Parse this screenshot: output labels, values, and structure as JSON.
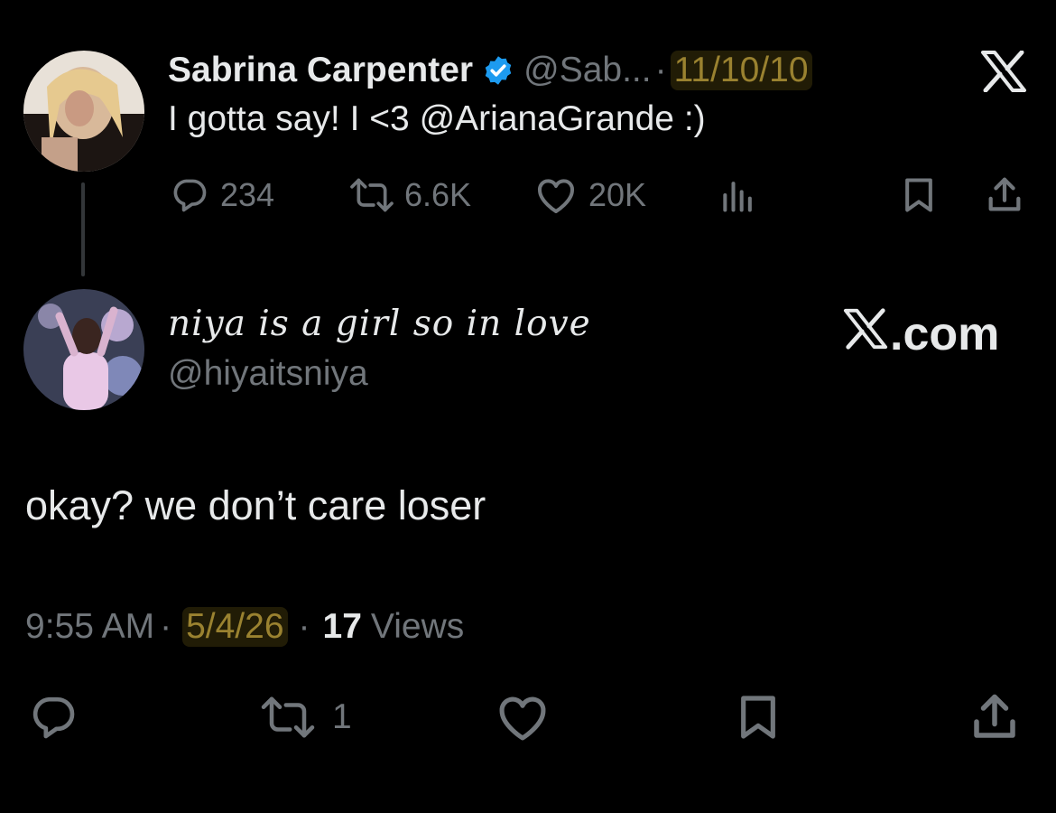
{
  "original_post": {
    "name": "Sabrina Carpenter",
    "handle": "@Sab...",
    "separator": "·",
    "date": "11/10/10",
    "text": "I gotta say! I <3 @ArianaGrande :)",
    "counts": {
      "replies": "234",
      "reposts": "6.6K",
      "likes": "20K"
    },
    "icons": [
      "reply-icon",
      "repost-icon",
      "like-icon",
      "views-icon",
      "bookmark-icon",
      "share-icon"
    ]
  },
  "reply": {
    "name": "niya is a girl so in love",
    "handle": "@hiyaitsniya",
    "text": "okay? we don’t care loser",
    "time": "9:55 AM",
    "separator": "·",
    "date": "5/4/26",
    "views_count": "17",
    "views_label": "Views",
    "counts": {
      "reposts": "1"
    }
  },
  "watermark": {
    "text": ".com"
  },
  "colors": {
    "background": "#000000",
    "text": "#e7e9ea",
    "muted": "#71767b",
    "verified": "#1d9bf0",
    "highlight": "#9a8230"
  }
}
